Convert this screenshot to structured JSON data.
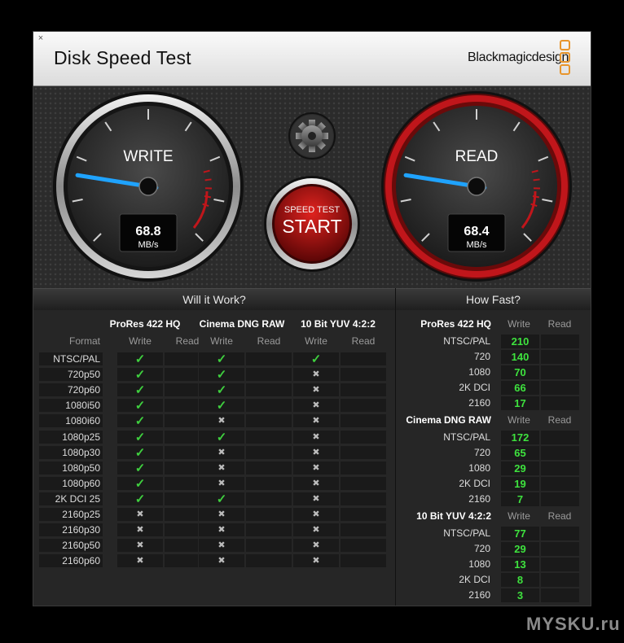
{
  "window": {
    "close_glyph": "×",
    "title": "Disk Speed Test",
    "brand": "Blackmagicdesign"
  },
  "gauges": {
    "write": {
      "label": "WRITE",
      "value": "68.8",
      "unit": "MB/s",
      "needle_fraction": 0.2
    },
    "read": {
      "label": "READ",
      "value": "68.4",
      "unit": "MB/s",
      "needle_fraction": 0.2
    },
    "settings_icon": "gear-icon",
    "start_button": {
      "line1": "SPEED TEST",
      "line2": "START"
    }
  },
  "colors": {
    "accent_red": "#c0161b",
    "needle_blue": "#1fa3ff",
    "ok_green": "#3fcf3f",
    "speed_green": "#3ee23e",
    "brand_orange": "#e8952c"
  },
  "will_it_work": {
    "heading": "Will it Work?",
    "format_label": "Format",
    "codecs": [
      "ProRes 422 HQ",
      "Cinema DNG RAW",
      "10 Bit YUV 4:2:2"
    ],
    "sub_labels": [
      "Write",
      "Read"
    ],
    "rows": [
      {
        "format": "NTSC/PAL",
        "w": [
          "ok",
          "ok",
          "ok"
        ]
      },
      {
        "format": "720p50",
        "w": [
          "ok",
          "ok",
          "no"
        ]
      },
      {
        "format": "720p60",
        "w": [
          "ok",
          "ok",
          "no"
        ]
      },
      {
        "format": "1080i50",
        "w": [
          "ok",
          "ok",
          "no"
        ]
      },
      {
        "format": "1080i60",
        "w": [
          "ok",
          "no",
          "no"
        ]
      },
      {
        "format": "1080p25",
        "w": [
          "ok",
          "ok",
          "no"
        ]
      },
      {
        "format": "1080p30",
        "w": [
          "ok",
          "no",
          "no"
        ]
      },
      {
        "format": "1080p50",
        "w": [
          "ok",
          "no",
          "no"
        ]
      },
      {
        "format": "1080p60",
        "w": [
          "ok",
          "no",
          "no"
        ]
      },
      {
        "format": "2K DCI 25",
        "w": [
          "ok",
          "ok",
          "no"
        ]
      },
      {
        "format": "2160p25",
        "w": [
          "no",
          "no",
          "no"
        ]
      },
      {
        "format": "2160p30",
        "w": [
          "no",
          "no",
          "no"
        ]
      },
      {
        "format": "2160p50",
        "w": [
          "no",
          "no",
          "no"
        ]
      },
      {
        "format": "2160p60",
        "w": [
          "no",
          "no",
          "no"
        ]
      }
    ],
    "ok_glyph": "✓",
    "no_glyph": "✖"
  },
  "how_fast": {
    "heading": "How Fast?",
    "sub_labels": [
      "Write",
      "Read"
    ],
    "groups": [
      {
        "title": "ProRes 422 HQ",
        "rows": [
          {
            "format": "NTSC/PAL",
            "write": "210"
          },
          {
            "format": "720",
            "write": "140"
          },
          {
            "format": "1080",
            "write": "70"
          },
          {
            "format": "2K DCI",
            "write": "66"
          },
          {
            "format": "2160",
            "write": "17"
          }
        ]
      },
      {
        "title": "Cinema DNG RAW",
        "rows": [
          {
            "format": "NTSC/PAL",
            "write": "172"
          },
          {
            "format": "720",
            "write": "65"
          },
          {
            "format": "1080",
            "write": "29"
          },
          {
            "format": "2K DCI",
            "write": "19"
          },
          {
            "format": "2160",
            "write": "7"
          }
        ]
      },
      {
        "title": "10 Bit YUV 4:2:2",
        "rows": [
          {
            "format": "NTSC/PAL",
            "write": "77"
          },
          {
            "format": "720",
            "write": "29"
          },
          {
            "format": "1080",
            "write": "13"
          },
          {
            "format": "2K DCI",
            "write": "8"
          },
          {
            "format": "2160",
            "write": "3"
          }
        ]
      }
    ]
  },
  "watermark": "MYSKU.ru"
}
